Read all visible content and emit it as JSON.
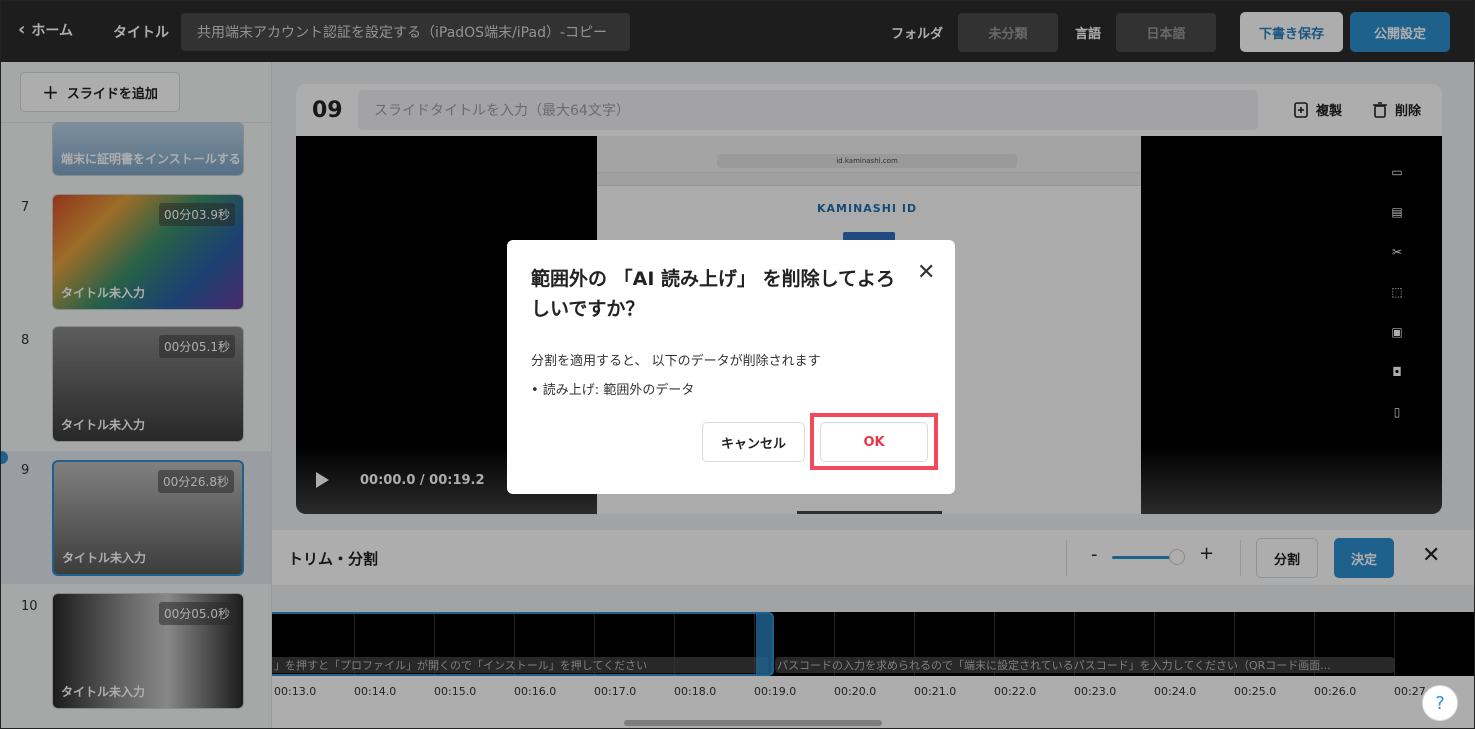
{
  "topbar": {
    "home": "ホーム",
    "title_label": "タイトル",
    "title_value": "共用端末アカウント認証を設定する（iPadOS端末/iPad）-コピー",
    "folder_label": "フォルダ",
    "folder_value": "未分類",
    "lang_label": "言語",
    "lang_value": "日本語",
    "draft_button": "下書き保存",
    "publish_button": "公開設定"
  },
  "sidebar": {
    "add_slide": "スライドを追加",
    "partial_caption": "端末に証明書をインストールする",
    "slides": [
      {
        "num": "7",
        "duration": "00分03.9秒",
        "caption": "タイトル未入力"
      },
      {
        "num": "8",
        "duration": "00分05.1秒",
        "caption": "タイトル未入力"
      },
      {
        "num": "9",
        "duration": "00分26.8秒",
        "caption": "タイトル未入力"
      },
      {
        "num": "10",
        "duration": "00分05.0秒",
        "caption": "タイトル未入力"
      }
    ]
  },
  "editor": {
    "slide_number": "09",
    "title_placeholder": "スライドタイトルを入力（最大64文字）",
    "duplicate": "複製",
    "delete": "削除",
    "video_url": "id.kaminashi.com",
    "video_logo": "KAMINASHI ID",
    "time": "00:00.0 / 00:19.2",
    "trim_label": "トリム・分割",
    "zoom_minus": "-",
    "zoom_plus": "+",
    "split_button": "分割",
    "confirm_button": "決定"
  },
  "timeline": {
    "subtitle1": "」を押すと「プロファイル」が開くので「インストール」を押してください",
    "subtitle2": "パスコードの入力を求められるので「端末に設定されているパスコード」を入力してください（QRコード画面...",
    "ticks": [
      "00:13.0",
      "00:14.0",
      "00:15.0",
      "00:16.0",
      "00:17.0",
      "00:18.0",
      "00:19.0",
      "00:20.0",
      "00:21.0",
      "00:22.0",
      "00:23.0",
      "00:24.0",
      "00:25.0",
      "00:26.0",
      "00:27"
    ]
  },
  "modal": {
    "heading": "範囲外の 「AI 読み上げ」 を削除してよろしいですか？",
    "body": "分割を適用すると、 以下のデータが削除されます",
    "bullet": "•  読み上げ: 範囲外のデータ",
    "cancel": "キャンセル",
    "ok": "OK"
  },
  "help": "?"
}
